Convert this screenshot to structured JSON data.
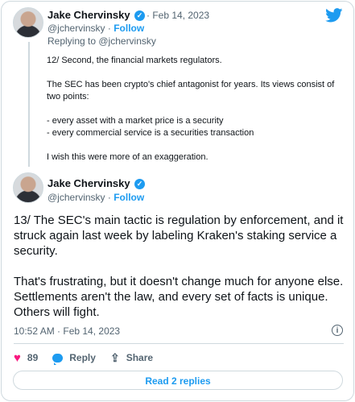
{
  "quoted_tweet": {
    "author_name": "Jake Chervinsky",
    "handle": "@jchervinsky",
    "date": "Feb 14, 2023",
    "follow_label": "Follow",
    "replying_to": "Replying to @jchervinsky",
    "paragraphs": [
      "12/ Second, the financial markets regulators.",
      "The SEC has been crypto's chief antagonist for years. Its views consist of two points:",
      "- every asset with a market price is a security",
      "- every commercial service is a securities transaction",
      "I wish this were more of an exaggeration."
    ]
  },
  "main_tweet": {
    "author_name": "Jake Chervinsky",
    "handle": "@jchervinsky",
    "follow_label": "Follow",
    "paragraphs": [
      "13/ The SEC's main tactic is regulation by enforcement, and it struck again last week by labeling Kraken's staking service a security.",
      "That's frustrating, but it doesn't change much for anyone else. Settlements aren't the law, and every set of facts is unique. Others will fight."
    ],
    "timestamp": "10:52 AM · Feb 14, 2023"
  },
  "actions": {
    "like_count": "89",
    "reply_label": "Reply",
    "share_label": "Share"
  },
  "read_replies_label": "Read 2 replies",
  "colors": {
    "accent": "#1d9bf0",
    "like": "#f91880",
    "muted": "#536471"
  },
  "icons": {
    "brand": "twitter-bird-icon",
    "info": "info-icon",
    "like": "heart-icon",
    "reply": "reply-icon",
    "share": "share-icon"
  }
}
